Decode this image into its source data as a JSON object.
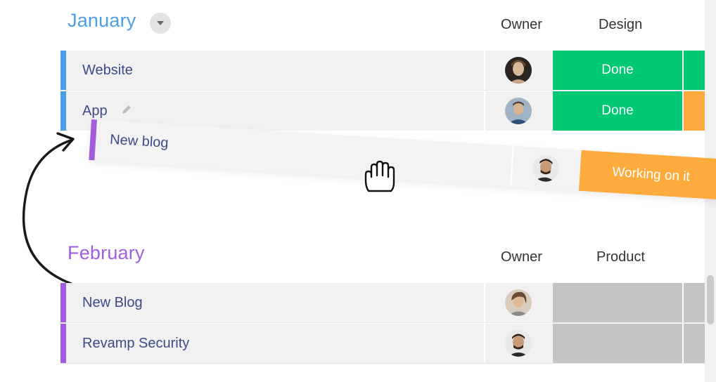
{
  "groups": {
    "january": {
      "title": "January",
      "color": "#4a9ee8",
      "columns": {
        "owner": "Owner",
        "design": "Design"
      },
      "rows": [
        {
          "label": "Website",
          "status": "Done",
          "status_color": "#00c875"
        },
        {
          "label": "App",
          "status": "Done",
          "status_color": "#00c875"
        }
      ]
    },
    "february": {
      "title": "February",
      "color": "#a25ddc",
      "columns": {
        "owner": "Owner",
        "product": "Product"
      },
      "rows": [
        {
          "label": "New Blog",
          "status": "",
          "status_color": "#c4c4c4"
        },
        {
          "label": "Revamp Security",
          "status": "",
          "status_color": "#c4c4c4"
        }
      ]
    }
  },
  "dragged_item": {
    "label": "New blog",
    "status": "Working on it",
    "status_color": "#fdab3d"
  },
  "icons": {
    "group_toggle": "chevron-down-icon",
    "edit": "pencil-icon",
    "cursor": "grab-hand-icon",
    "move_hint": "curved-arrow-icon"
  }
}
